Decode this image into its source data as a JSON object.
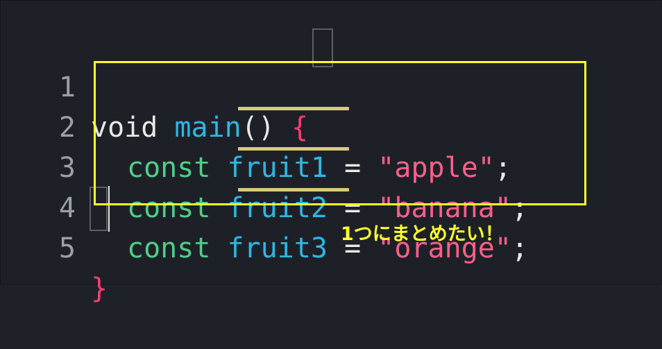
{
  "colors": {
    "background": "#1d2127",
    "keyword": "#4fcf8a",
    "identifier": "#2fb6e6",
    "string": "#ff5f8a",
    "brace": "#ff3d6e",
    "line_number": "#9aa0a6",
    "highlight_box": "#ffff2e",
    "underline": "#d9c97a"
  },
  "lines": [
    {
      "number": "1",
      "void": "void",
      "fn": "main",
      "parens": "()",
      "brace": "{"
    },
    {
      "number": "2",
      "kw": "const",
      "ident": "fruit1",
      "op": "=",
      "str": "\"apple\"",
      "semi": ";"
    },
    {
      "number": "3",
      "kw": "const",
      "ident": "fruit2",
      "op": "=",
      "str": "\"banana\"",
      "semi": ";"
    },
    {
      "number": "4",
      "kw": "const",
      "ident": "fruit3",
      "op": "=",
      "str": "\"orange\"",
      "semi": ";"
    },
    {
      "number": "5",
      "brace": "}"
    }
  ],
  "annotation": "1つにまとめたい！"
}
